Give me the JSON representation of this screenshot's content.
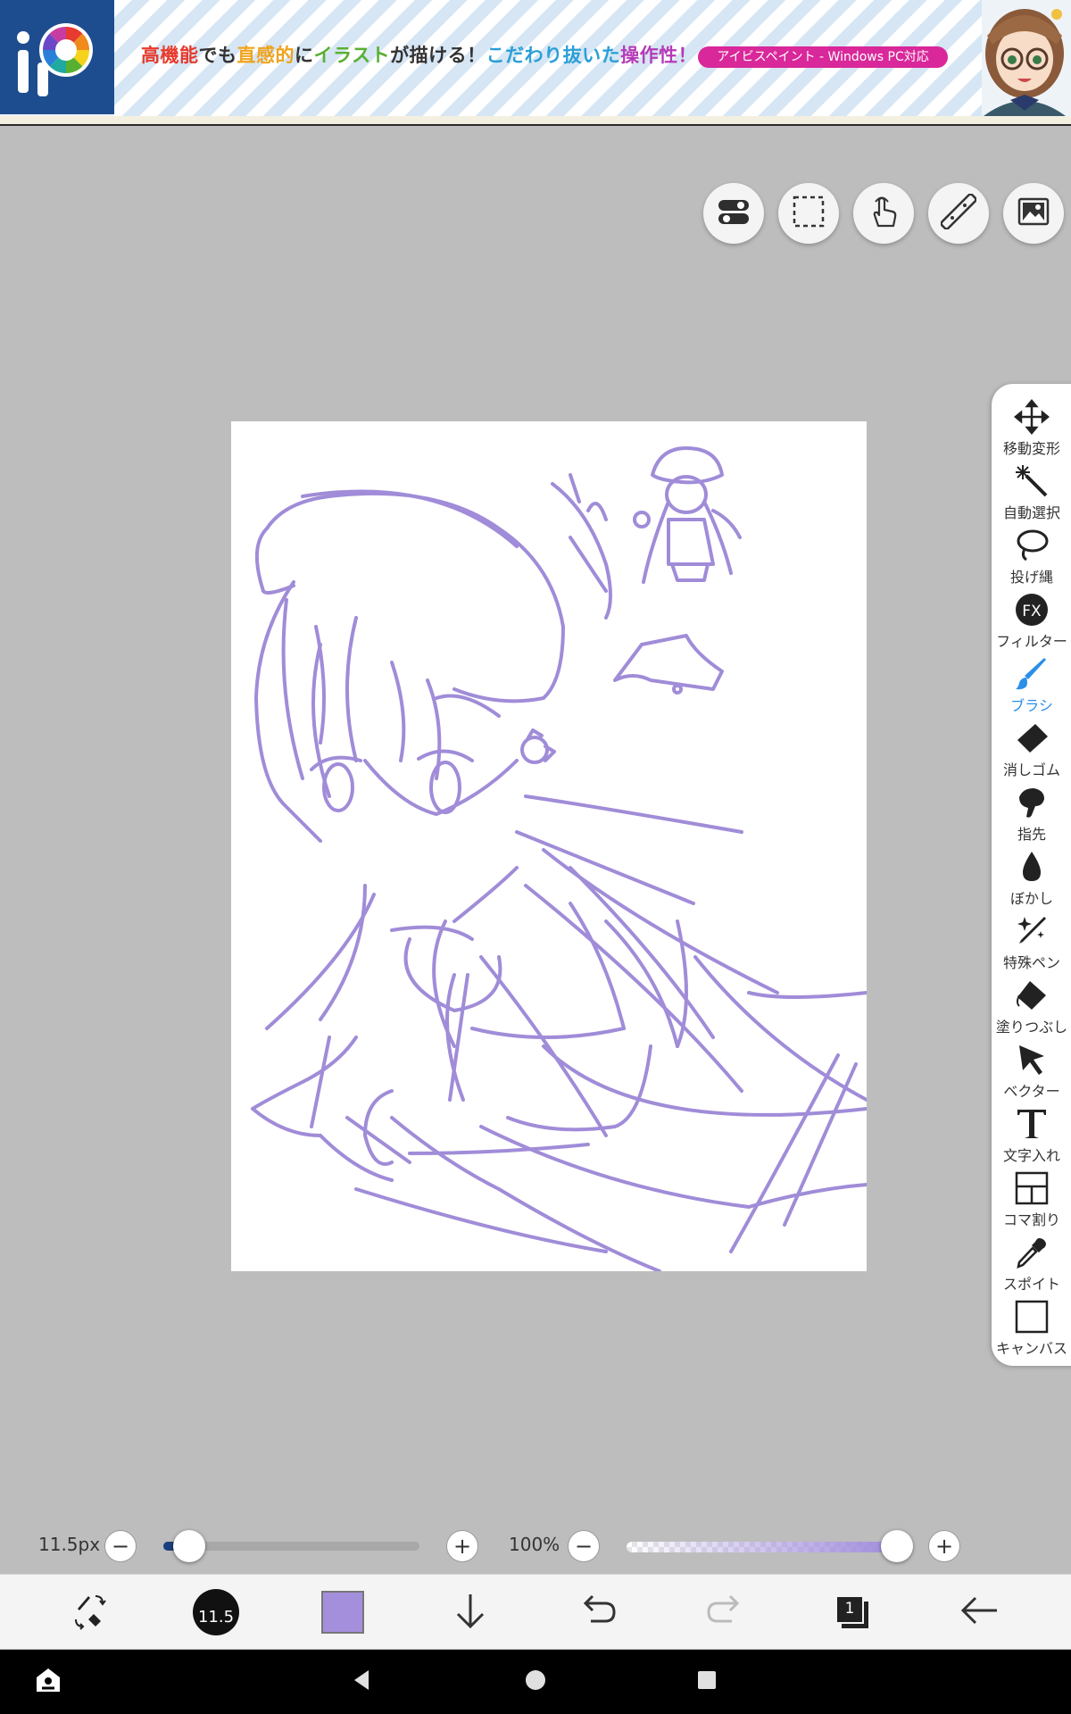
{
  "ad": {
    "tagline_parts": [
      {
        "text": "高機能",
        "color": "#e63b2e"
      },
      {
        "text": "でも",
        "color": "#333333"
      },
      {
        "text": "直感的",
        "color": "#f0a21b"
      },
      {
        "text": "に",
        "color": "#333333"
      },
      {
        "text": "イラスト",
        "color": "#58b031"
      },
      {
        "text": "が描ける！",
        "color": "#333333"
      },
      {
        "text": "こだわり抜いた",
        "color": "#2a9fd8"
      },
      {
        "text": "操作性！",
        "color": "#b43bb8"
      }
    ],
    "pill": "アイビスペイント - Windows PC対応",
    "logo_icon": "ibis-paint-logo",
    "mascot": "mascot-girl"
  },
  "top_toolbar": [
    {
      "name": "toggle-icon"
    },
    {
      "name": "selection-rect-icon"
    },
    {
      "name": "hand-touch-icon"
    },
    {
      "name": "ruler-icon"
    },
    {
      "name": "image-gallery-icon"
    }
  ],
  "tools": [
    {
      "id": "move",
      "label": "移動変形",
      "icon": "move-arrows-icon"
    },
    {
      "id": "magic-wand",
      "label": "自動選択",
      "icon": "magic-wand-icon"
    },
    {
      "id": "lasso",
      "label": "投げ縄",
      "icon": "lasso-icon"
    },
    {
      "id": "filter",
      "label": "フィルター",
      "icon": "fx-icon"
    },
    {
      "id": "brush",
      "label": "ブラシ",
      "icon": "brush-icon",
      "active": true
    },
    {
      "id": "eraser",
      "label": "消しゴム",
      "icon": "eraser-icon"
    },
    {
      "id": "smudge",
      "label": "指先",
      "icon": "finger-icon"
    },
    {
      "id": "blur",
      "label": "ぼかし",
      "icon": "drop-icon"
    },
    {
      "id": "special-pen",
      "label": "特殊ペン",
      "icon": "sparkle-pen-icon"
    },
    {
      "id": "fill",
      "label": "塗りつぶし",
      "icon": "fill-bucket-icon"
    },
    {
      "id": "vector",
      "label": "ベクター",
      "icon": "cursor-arrow-icon"
    },
    {
      "id": "text",
      "label": "文字入れ",
      "icon": "text-t-icon"
    },
    {
      "id": "frame",
      "label": "コマ割り",
      "icon": "frame-divider-icon"
    },
    {
      "id": "eyedropper",
      "label": "スポイト",
      "icon": "eyedropper-icon"
    },
    {
      "id": "canvas",
      "label": "キャンバス",
      "icon": "canvas-square-icon"
    }
  ],
  "brush": {
    "size_label": "11.5px",
    "size_badge": "11.5",
    "size_fraction": 0.06,
    "opacity_label": "100%",
    "opacity_fraction": 1.0,
    "minus": "−",
    "plus": "+"
  },
  "colors": {
    "current": "#a48fdc",
    "sketch": "#a08cd8",
    "accent": "#2b8fe8"
  },
  "bottom_actions": [
    {
      "name": "brush-eraser-swap-icon"
    },
    {
      "name": "brush-size-icon"
    },
    {
      "name": "color-swatch"
    },
    {
      "name": "download-arrow-icon"
    },
    {
      "name": "undo-icon"
    },
    {
      "name": "redo-icon"
    },
    {
      "name": "layers-icon",
      "badge": "1"
    },
    {
      "name": "back-arrow-icon"
    }
  ]
}
